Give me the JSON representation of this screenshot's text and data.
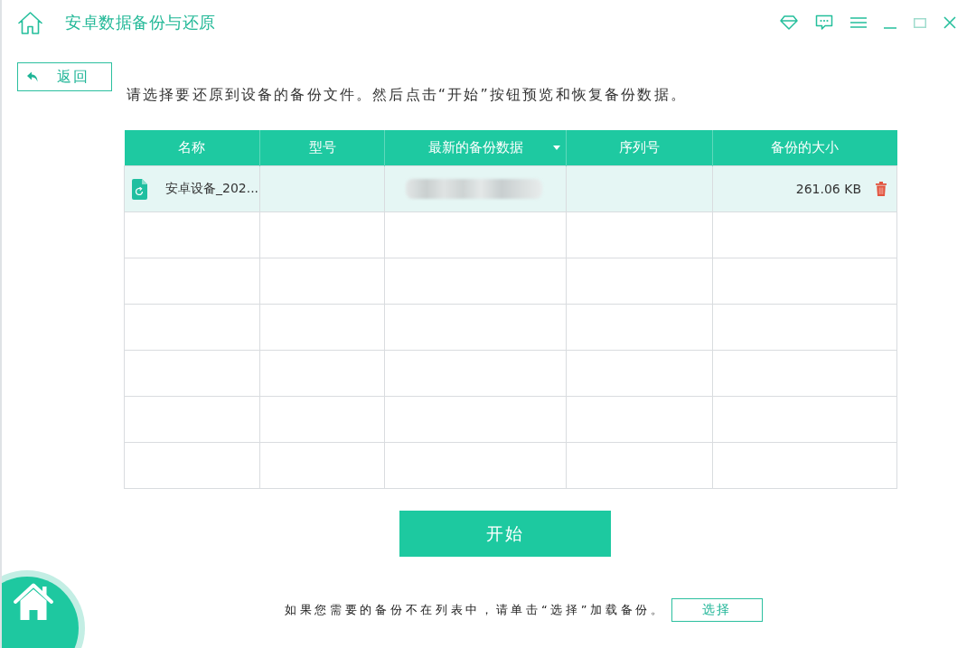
{
  "window": {
    "title": "安卓数据备份与还原"
  },
  "back_button": {
    "label": "返回"
  },
  "instruction": "请选择要还原到设备的备份文件。然后点击“开始”按钮预览和恢复备份数据。",
  "table": {
    "columns": [
      {
        "label": "名称",
        "sorted": false
      },
      {
        "label": "型号",
        "sorted": false
      },
      {
        "label": "最新的备份数据",
        "sorted": true
      },
      {
        "label": "序列号",
        "sorted": false
      },
      {
        "label": "备份的大小",
        "sorted": false
      }
    ],
    "rows": [
      {
        "name": "安卓设备_202...",
        "latest_backup_blurred": true,
        "size": "261.06 KB",
        "selected": true
      }
    ]
  },
  "start_button": {
    "label": "开始"
  },
  "footer": {
    "hint": "如果您需要的备份不在列表中，请单击“选择”加载备份。",
    "select_button": {
      "label": "选择"
    }
  }
}
